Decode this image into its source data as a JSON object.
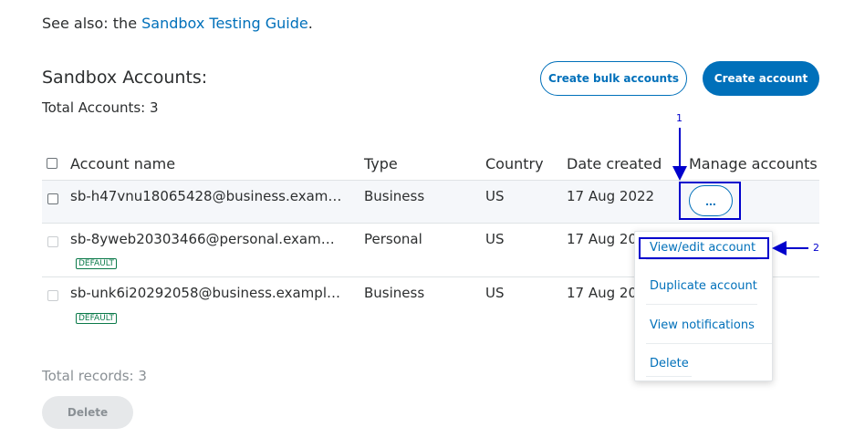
{
  "see_also": {
    "prefix": "See also: the ",
    "link": "Sandbox Testing Guide",
    "suffix": "."
  },
  "section_title": "Sandbox Accounts:",
  "total_accounts": "Total Accounts: 3",
  "buttons": {
    "create_bulk": "Create bulk accounts",
    "create_account": "Create account",
    "delete": "Delete"
  },
  "table": {
    "headers": {
      "account_name": "Account name",
      "type": "Type",
      "country": "Country",
      "date_created": "Date created",
      "manage": "Manage accounts"
    },
    "rows": [
      {
        "name": "sb-h47vnu18065428@business.exam…",
        "type": "Business",
        "country": "US",
        "date": "17 Aug 2022",
        "badge": ""
      },
      {
        "name": "sb-8yweb20303466@personal.exam…",
        "type": "Personal",
        "country": "US",
        "date": "17 Aug 20",
        "badge": "DEFAULT"
      },
      {
        "name": "sb-unk6i20292058@business.exampl…",
        "type": "Business",
        "country": "US",
        "date": "17 Aug 20",
        "badge": "DEFAULT"
      }
    ]
  },
  "manage_button_label": "...",
  "menu": {
    "items": [
      "View/edit account",
      "Duplicate account",
      "View notifications",
      "Delete"
    ]
  },
  "annotations": {
    "one": "1",
    "two": "2"
  },
  "total_records": "Total records: 3",
  "colors": {
    "accent": "#0070ba",
    "annotation": "#0000cc",
    "badge": "#0b7a4a"
  }
}
